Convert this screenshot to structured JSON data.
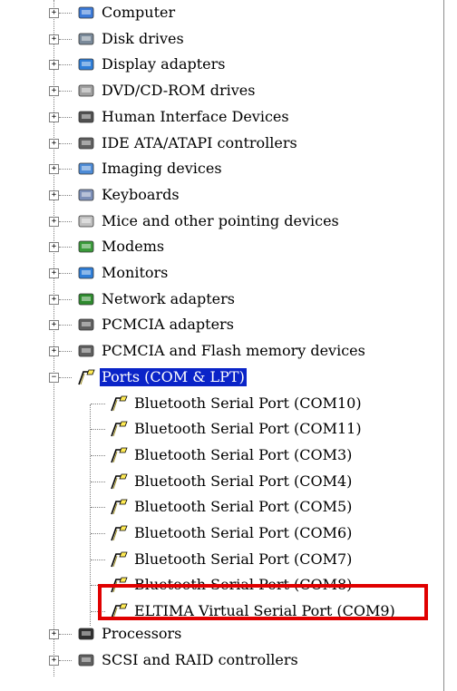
{
  "categories_top": [
    {
      "label": "Computer",
      "icon": "computer-icon",
      "color": "#3c7ad8"
    },
    {
      "label": "Disk drives",
      "icon": "disk-drive-icon",
      "color": "#7a8a9a"
    },
    {
      "label": "Display adapters",
      "icon": "display-adapter-icon",
      "color": "#2f7ed8"
    },
    {
      "label": "DVD/CD-ROM drives",
      "icon": "cdrom-drive-icon",
      "color": "#a0a0a0"
    },
    {
      "label": "Human Interface Devices",
      "icon": "hid-icon",
      "color": "#505050"
    },
    {
      "label": "IDE ATA/ATAPI controllers",
      "icon": "ide-controller-icon",
      "color": "#606060"
    },
    {
      "label": "Imaging devices",
      "icon": "imaging-device-icon",
      "color": "#4d8bd6"
    },
    {
      "label": "Keyboards",
      "icon": "keyboard-icon",
      "color": "#7c8fb8"
    },
    {
      "label": "Mice and other pointing devices",
      "icon": "mouse-icon",
      "color": "#c0c0c0"
    },
    {
      "label": "Modems",
      "icon": "modem-icon",
      "color": "#3a9a3a"
    },
    {
      "label": "Monitors",
      "icon": "monitor-icon",
      "color": "#2f7ed8"
    },
    {
      "label": "Network adapters",
      "icon": "network-adapter-icon",
      "color": "#2e8b2e"
    },
    {
      "label": "PCMCIA adapters",
      "icon": "pcmcia-icon",
      "color": "#606060"
    },
    {
      "label": "PCMCIA and Flash memory devices",
      "icon": "flash-memory-icon",
      "color": "#606060"
    }
  ],
  "ports": {
    "label": "Ports (COM & LPT)",
    "children": [
      "Bluetooth Serial Port (COM10)",
      "Bluetooth Serial Port (COM11)",
      "Bluetooth Serial Port (COM3)",
      "Bluetooth Serial Port (COM4)",
      "Bluetooth Serial Port (COM5)",
      "Bluetooth Serial Port (COM6)",
      "Bluetooth Serial Port (COM7)",
      "Bluetooth Serial Port (COM8)",
      "ELTIMA Virtual Serial Port (COM9)"
    ]
  },
  "categories_bottom": [
    {
      "label": "Processors",
      "icon": "processor-icon",
      "color": "#303030"
    },
    {
      "label": "SCSI and RAID controllers",
      "icon": "scsi-controller-icon",
      "color": "#606060"
    }
  ],
  "expand_symbol": "+",
  "collapse_symbol": "−",
  "highlight_color": "#e00000",
  "selection_color": "#0a24c8"
}
